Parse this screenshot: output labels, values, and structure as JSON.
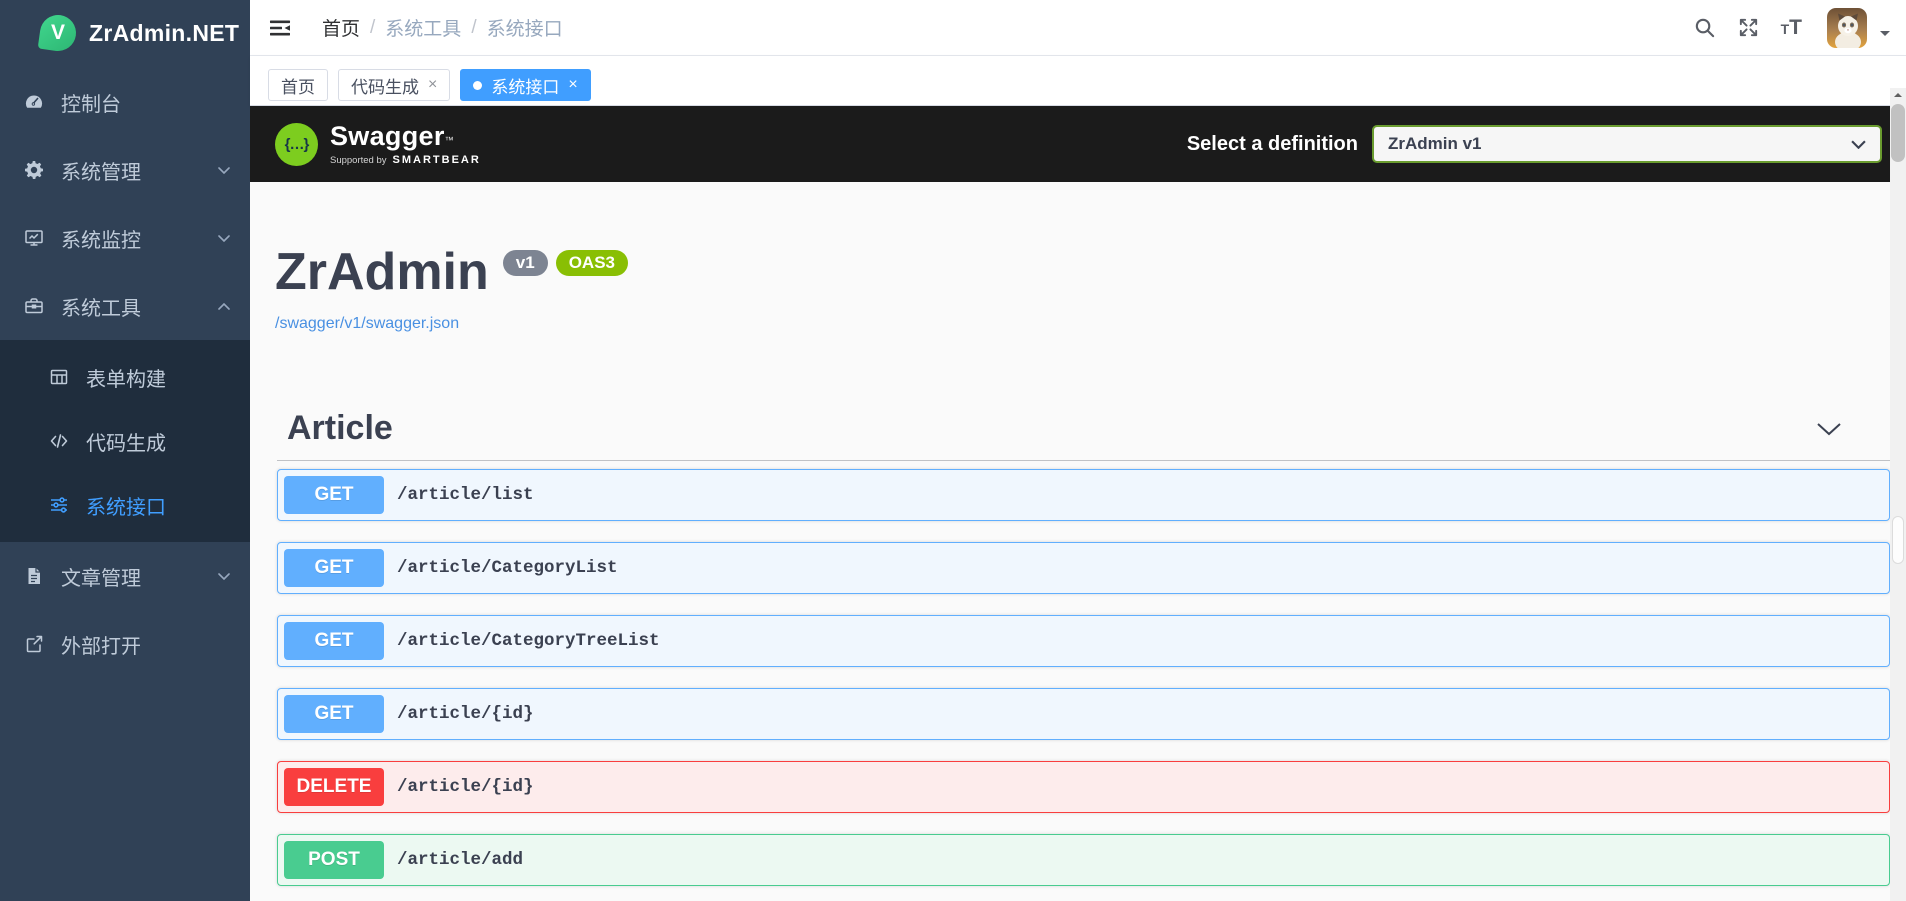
{
  "app": {
    "title": "ZrAdmin.NET",
    "logo_letter": "V"
  },
  "sidebar": {
    "items": [
      {
        "label": "控制台",
        "icon": "dashboard-icon"
      },
      {
        "label": "系统管理",
        "icon": "gear-icon"
      },
      {
        "label": "系统监控",
        "icon": "monitor-icon"
      },
      {
        "label": "系统工具",
        "icon": "toolbox-icon",
        "expanded": true
      },
      {
        "label": "文章管理",
        "icon": "document-icon"
      },
      {
        "label": "外部打开",
        "icon": "external-link-icon"
      }
    ],
    "submenu": [
      {
        "label": "表单构建",
        "icon": "table-icon"
      },
      {
        "label": "代码生成",
        "icon": "code-icon"
      },
      {
        "label": "系统接口",
        "icon": "sliders-icon",
        "active": true
      }
    ]
  },
  "navbar": {
    "breadcrumb": [
      "首页",
      "系统工具",
      "系统接口"
    ],
    "separator": "/"
  },
  "tabs": [
    {
      "label": "首页"
    },
    {
      "label": "代码生成",
      "closable": true
    },
    {
      "label": "系统接口",
      "closable": true,
      "active": true
    }
  ],
  "glyphs": {
    "close": "×"
  },
  "swagger": {
    "topbar": {
      "logo_glyph": "{…}",
      "brand": "Swagger",
      "tm": "™",
      "supported_by": "Supported by",
      "smartbear": "SMARTBEAR",
      "select_label": "Select a definition",
      "selected": "ZrAdmin v1"
    },
    "info": {
      "title": "ZrAdmin",
      "version": "v1",
      "oas": "OAS3",
      "spec_url": "/swagger/v1/swagger.json"
    },
    "section": {
      "title": "Article"
    },
    "endpoints": [
      {
        "method": "GET",
        "path": "/article/list"
      },
      {
        "method": "GET",
        "path": "/article/CategoryList"
      },
      {
        "method": "GET",
        "path": "/article/CategoryTreeList"
      },
      {
        "method": "GET",
        "path": "/article/{id}"
      },
      {
        "method": "DELETE",
        "path": "/article/{id}"
      },
      {
        "method": "POST",
        "path": "/article/add"
      }
    ]
  },
  "colors": {
    "sidebar_bg": "#304156",
    "submenu_bg": "#1f2d3d",
    "active_blue": "#409eff",
    "topbar_bg": "#1b1b1b",
    "get": "#61affe",
    "post": "#49cc90",
    "delete": "#f93e3e",
    "oas3_green": "#89bf04",
    "version_gray": "#7d8492",
    "link_blue": "#4990e2",
    "title_gray": "#3b4151"
  }
}
